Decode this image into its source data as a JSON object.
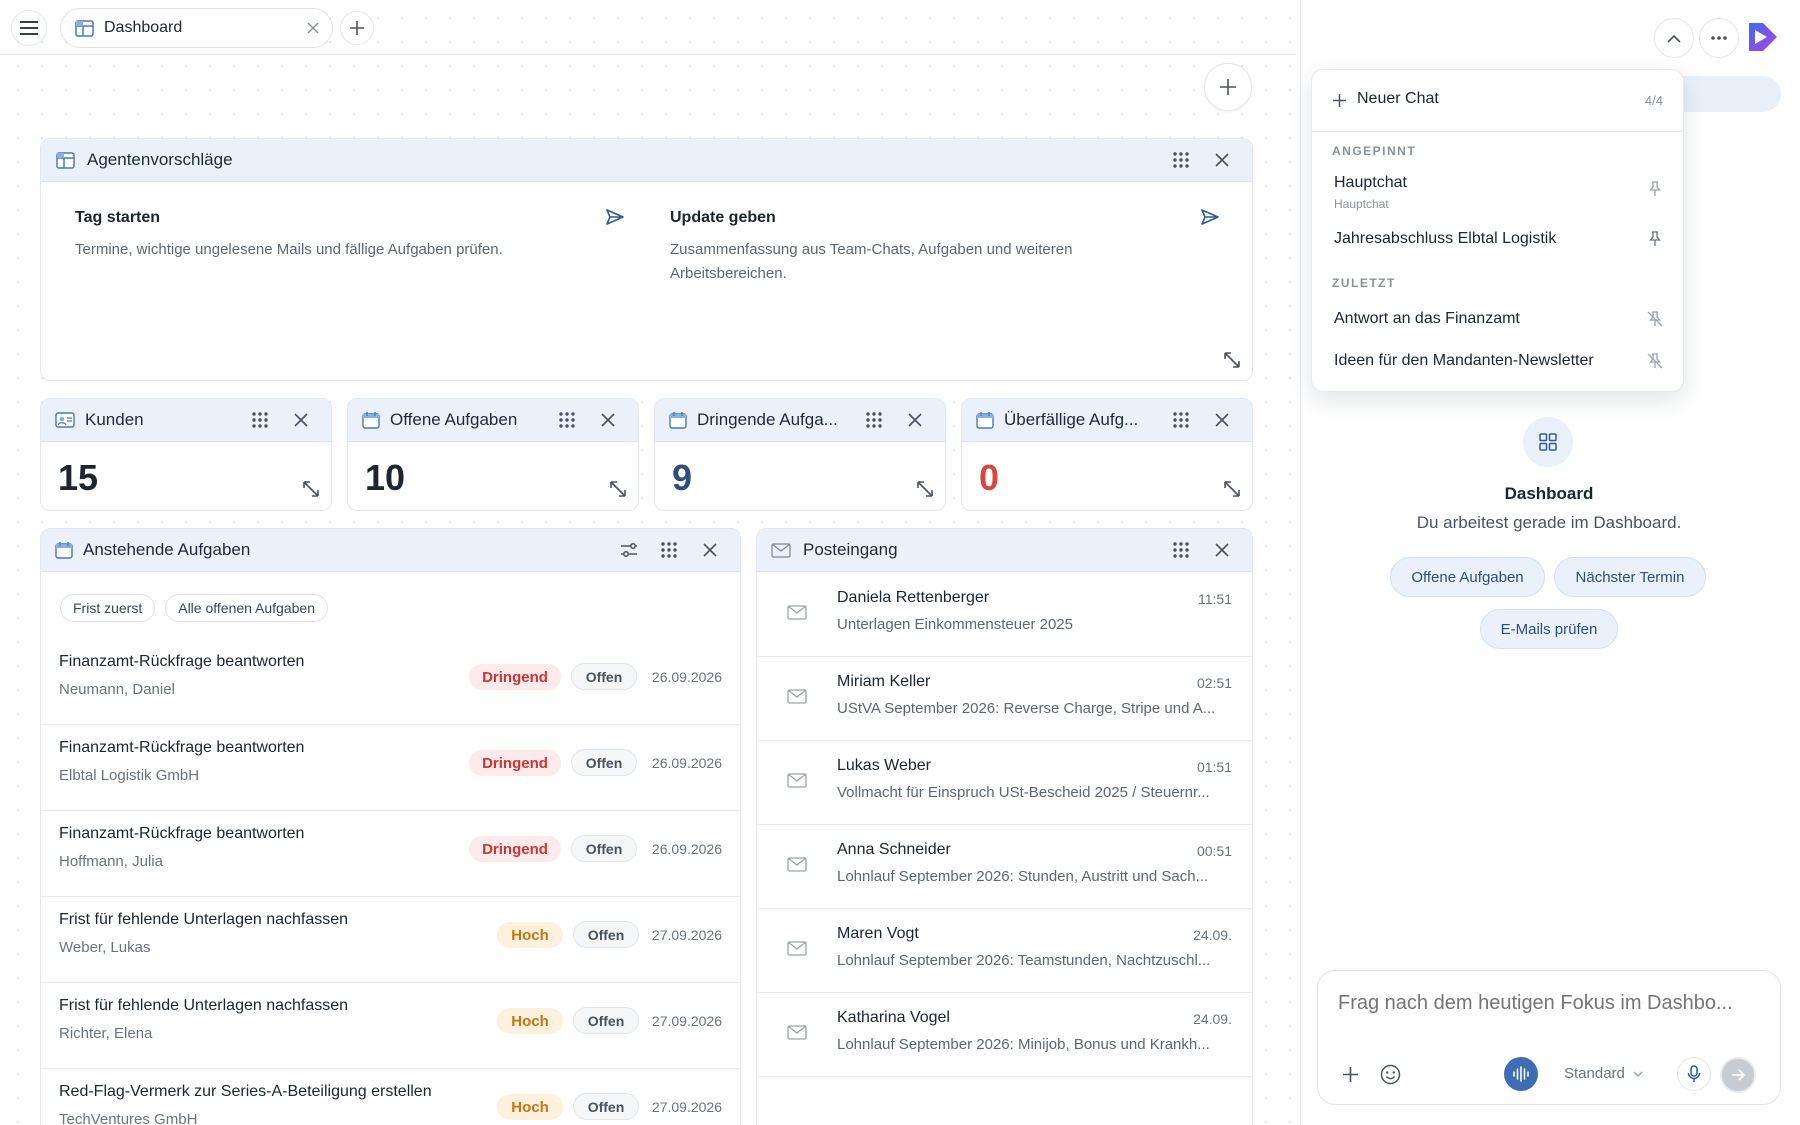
{
  "tabs": {
    "active_label": "Dashboard"
  },
  "agent": {
    "title": "Agentenvorschläge",
    "cards": [
      {
        "title": "Tag starten",
        "text": "Termine, wichtige ungelesene Mails und fällige Aufgaben prüfen."
      },
      {
        "title": "Update geben",
        "text": "Zusammenfassung aus Team-Chats, Aufgaben und weiteren Arbeitsbereichen."
      }
    ]
  },
  "stats": [
    {
      "title": "Kunden",
      "value": "15",
      "color": "#1d2530"
    },
    {
      "title": "Offene Aufgaben",
      "value": "10",
      "color": "#1d2530"
    },
    {
      "title": "Dringende Aufga...",
      "value": "9",
      "color": "#2f4e78"
    },
    {
      "title": "Überfällige Aufg...",
      "value": "0",
      "color": "#d9463f"
    }
  ],
  "tasks": {
    "title": "Anstehende Aufgaben",
    "filters": [
      "Frist zuerst",
      "Alle offenen Aufgaben"
    ],
    "rows": [
      {
        "title": "Finanzamt-Rückfrage beantworten",
        "sub": "Neumann, Daniel",
        "priority": "Dringend",
        "status": "Offen",
        "date": "26.09.2026"
      },
      {
        "title": "Finanzamt-Rückfrage beantworten",
        "sub": "Elbtal Logistik GmbH",
        "priority": "Dringend",
        "status": "Offen",
        "date": "26.09.2026"
      },
      {
        "title": "Finanzamt-Rückfrage beantworten",
        "sub": "Hoffmann, Julia",
        "priority": "Dringend",
        "status": "Offen",
        "date": "26.09.2026"
      },
      {
        "title": "Frist für fehlende Unterlagen nachfassen",
        "sub": "Weber, Lukas",
        "priority": "Hoch",
        "status": "Offen",
        "date": "27.09.2026"
      },
      {
        "title": "Frist für fehlende Unterlagen nachfassen",
        "sub": "Richter, Elena",
        "priority": "Hoch",
        "status": "Offen",
        "date": "27.09.2026"
      },
      {
        "title": "Red-Flag-Vermerk zur Series-A-Beteiligung erstellen",
        "sub": "TechVentures GmbH",
        "priority": "Hoch",
        "status": "Offen",
        "date": "27.09.2026"
      }
    ]
  },
  "inbox": {
    "title": "Posteingang",
    "rows": [
      {
        "name": "Daniela Rettenberger",
        "time": "11:51",
        "subject": "Unterlagen Einkommensteuer 2025"
      },
      {
        "name": "Miriam Keller",
        "time": "02:51",
        "subject": "UStVA September 2026: Reverse Charge, Stripe und A..."
      },
      {
        "name": "Lukas Weber",
        "time": "01:51",
        "subject": "Vollmacht für Einspruch USt-Bescheid 2025 / Steuernr..."
      },
      {
        "name": "Anna Schneider",
        "time": "00:51",
        "subject": "Lohnlauf September 2026: Stunden, Austritt und Sach..."
      },
      {
        "name": "Maren Vogt",
        "time": "24.09.",
        "subject": "Lohnlauf September 2026: Teamstunden, Nachtzuschl..."
      },
      {
        "name": "Katharina Vogel",
        "time": "24.09.",
        "subject": "Lohnlauf September 2026: Minijob, Bonus und Krankh..."
      }
    ]
  },
  "chat_menu": {
    "new_chat": "Neuer Chat",
    "count": "4/4",
    "pinned_label": "ANGEPINNT",
    "pinned": [
      {
        "title": "Hauptchat",
        "sub": "Hauptchat"
      },
      {
        "title": "Jahresabschluss Elbtal Logistik"
      }
    ],
    "recent_label": "ZULETZT",
    "recent": [
      {
        "title": "Antwort an das Finanzamt"
      },
      {
        "title": "Ideen für den Mandanten-Newsletter"
      }
    ]
  },
  "assistant": {
    "context_title": "Dashboard",
    "context_sub": "Du arbeitest gerade im Dashboard.",
    "suggestions": [
      "Offene Aufgaben",
      "Nächster Termin",
      "E-Mails prüfen"
    ],
    "input_placeholder": "Frag nach dem heutigen Fokus im Dashbo...",
    "mode": "Standard"
  },
  "colors": {
    "accent": "#2f5a94",
    "header_bg": "#eaf1fb",
    "urgent": "#c93636",
    "high": "#c27611",
    "overdue": "#d9463f"
  }
}
